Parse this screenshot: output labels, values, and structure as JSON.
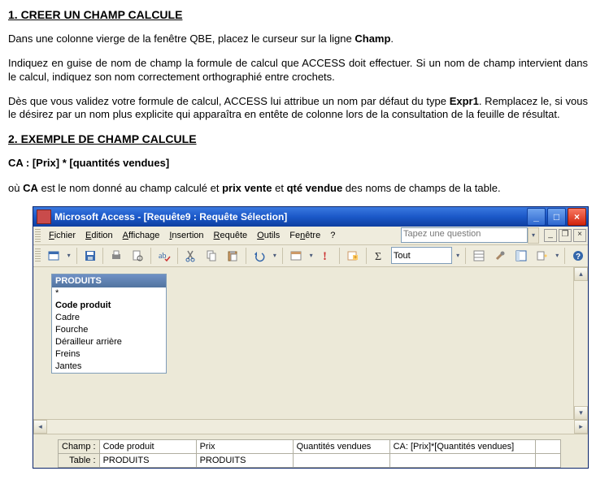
{
  "section1": {
    "heading": "1. CREER UN CHAMP CALCULE",
    "p1_a": "Dans une colonne vierge de la fenêtre QBE, placez le curseur sur la ligne ",
    "p1_b": "Champ",
    "p1_c": ".",
    "p2": "Indiquez en guise de nom de champ la formule de calcul que ACCESS doit effectuer. Si un nom de champ intervient dans le calcul, indiquez son nom correctement orthographié entre crochets.",
    "p3_a": "Dès que vous validez votre formule de calcul, ACCESS lui attribue un nom par défaut du type ",
    "p3_b": "Expr1",
    "p3_c": ". Remplacez le, si vous le désirez par un nom plus explicite qui apparaîtra en entête de colonne lors de la consultation de la feuille de résultat."
  },
  "section2": {
    "heading": "2. EXEMPLE DE CHAMP CALCULE",
    "formula": "CA : [Prix] * [quantités vendues]",
    "expl_a": "où ",
    "expl_b": "CA",
    "expl_c": " est le nom donné au champ calculé et ",
    "expl_d": "prix vente",
    "expl_e": " et ",
    "expl_f": "qté vendue",
    "expl_g": " des noms de champs de la table."
  },
  "access": {
    "title": "Microsoft Access - [Requête9 : Requête Sélection]",
    "menus": {
      "fichier": "Fichier",
      "edition": "Edition",
      "affichage": "Affichage",
      "insertion": "Insertion",
      "requete": "Requête",
      "outils": "Outils",
      "fenetre": "Fenêtre",
      "help": "?"
    },
    "question_placeholder": "Tapez une question",
    "toolbar": {
      "tout": "Tout"
    },
    "fieldlist": {
      "title": "PRODUITS",
      "rows": [
        "*",
        "Code produit",
        "Cadre",
        "Fourche",
        "Dérailleur arrière",
        "Freins",
        "Jantes"
      ]
    },
    "qbe": {
      "rowlabels": {
        "champ": "Champ :",
        "table": "Table :"
      },
      "cols": [
        {
          "champ": "Code produit",
          "table": "PRODUITS"
        },
        {
          "champ": "Prix",
          "table": "PRODUITS"
        },
        {
          "champ": "Quantités vendues",
          "table": ""
        },
        {
          "champ": "CA: [Prix]*[Quantités vendues]",
          "table": ""
        }
      ]
    }
  }
}
